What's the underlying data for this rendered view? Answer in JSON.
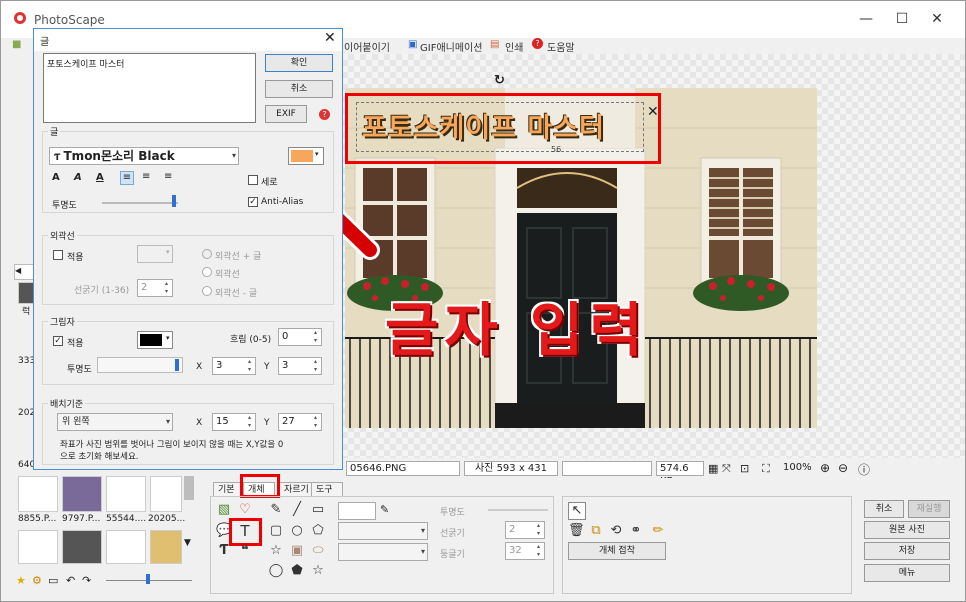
{
  "app": {
    "title": "PhotoScape",
    "menu": [
      "이어붙이기",
      "GIF애니메이션",
      "인쇄",
      "도움말"
    ]
  },
  "text_dialog": {
    "title": "글",
    "text_value": "포토스케이프 마스터",
    "buttons": {
      "ok": "확인",
      "cancel": "취소",
      "exif": "EXIF"
    },
    "font_section": {
      "label": "글",
      "font_name": "Tmon몬소리 Black",
      "color": "#f7a65a",
      "opacity_label": "투명도",
      "shadow_check_label": "세로",
      "antialias_label": "Anti-Alias"
    },
    "outline_section": {
      "label": "외곽선",
      "apply_label": "적용",
      "thickness_label": "선굵기 (1-36)",
      "thickness_value": "2",
      "options": [
        "외곽선 + 글",
        "외곽선",
        "외곽선 - 글"
      ]
    },
    "shadow_section": {
      "label": "그림자",
      "apply_label": "적용",
      "blur_label": "흐림 (0-5)",
      "blur_value": "0",
      "opacity_label": "투명도",
      "x_label": "X",
      "x_value": "3",
      "y_label": "Y",
      "y_value": "3"
    },
    "position_section": {
      "label": "배치기준",
      "anchor_value": "위 왼쪽",
      "x_label": "X",
      "x_value": "15",
      "y_label": "Y",
      "y_value": "27",
      "note": "좌표가 사진 범위를 벗어나 그림이 보이지 않을 때는 X,Y값을 0으로 초기화 해보세요."
    }
  },
  "canvas": {
    "overlay_text": "포토스케이프 마스터",
    "annotation": "글자 입력",
    "text_box_size_label": "56"
  },
  "status_bar": {
    "filename": "05646.PNG",
    "photo_size": "사진 593 x 431",
    "file_size": "574.6 KB",
    "zoom": "100%"
  },
  "file_pane": {
    "numbers": [
      "333",
      "202",
      "640"
    ],
    "thumbs": [
      "8855.P...",
      "9797.P...",
      "55544....",
      "20205..."
    ],
    "letter": "럭"
  },
  "bottom_tabs": [
    "기본",
    "개체",
    "자르기",
    "도구"
  ],
  "object_tools": {
    "opacity_label": "투명도",
    "line_width_label": "선굵기",
    "line_width_value": "2",
    "round_label": "둥글기",
    "round_value": "32",
    "attach_button": "개체 접착"
  },
  "right_buttons": {
    "undo": "취소",
    "redo": "재실행",
    "original": "원본 사진",
    "save": "저장",
    "menu": "메뉴"
  },
  "colors": {
    "accent_red": "#e00000",
    "text_orange": "#f7a65a",
    "dialog_border": "#4a90d9"
  }
}
